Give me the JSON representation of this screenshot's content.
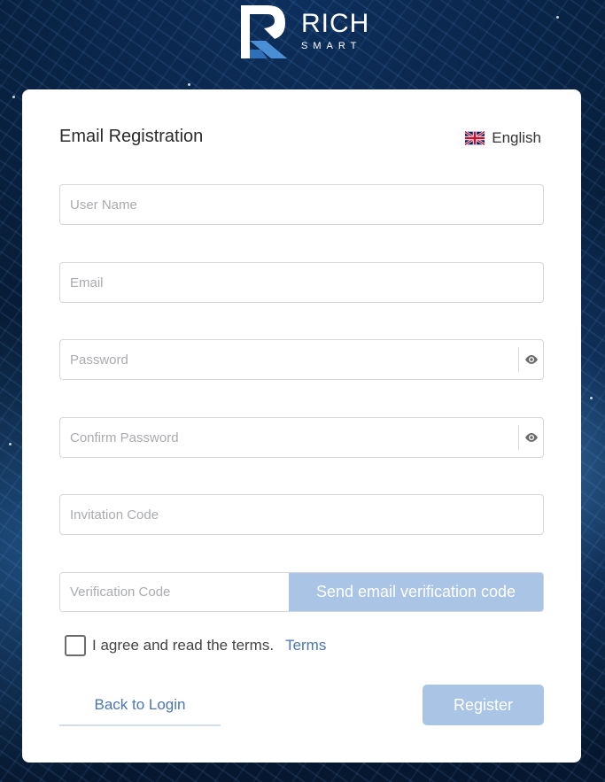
{
  "brand": {
    "name": "RICH",
    "sub": "SMART"
  },
  "form": {
    "title": "Email Registration",
    "language": {
      "label": "English",
      "flag_icon": "uk-flag-icon"
    },
    "fields": {
      "username_placeholder": "User Name",
      "email_placeholder": "Email",
      "password_placeholder": "Password",
      "confirm_password_placeholder": "Confirm Password",
      "invitation_placeholder": "Invitation Code",
      "verification_placeholder": "Verification Code"
    },
    "send_code_label": "Send email verification code",
    "agree_text": "I agree and read the terms.",
    "terms_link": "Terms",
    "back_label": "Back to Login",
    "register_label": "Register"
  },
  "colors": {
    "accent": "#4a76b0",
    "button_disabled": "#a9c4e4",
    "border": "#d4d6da"
  }
}
